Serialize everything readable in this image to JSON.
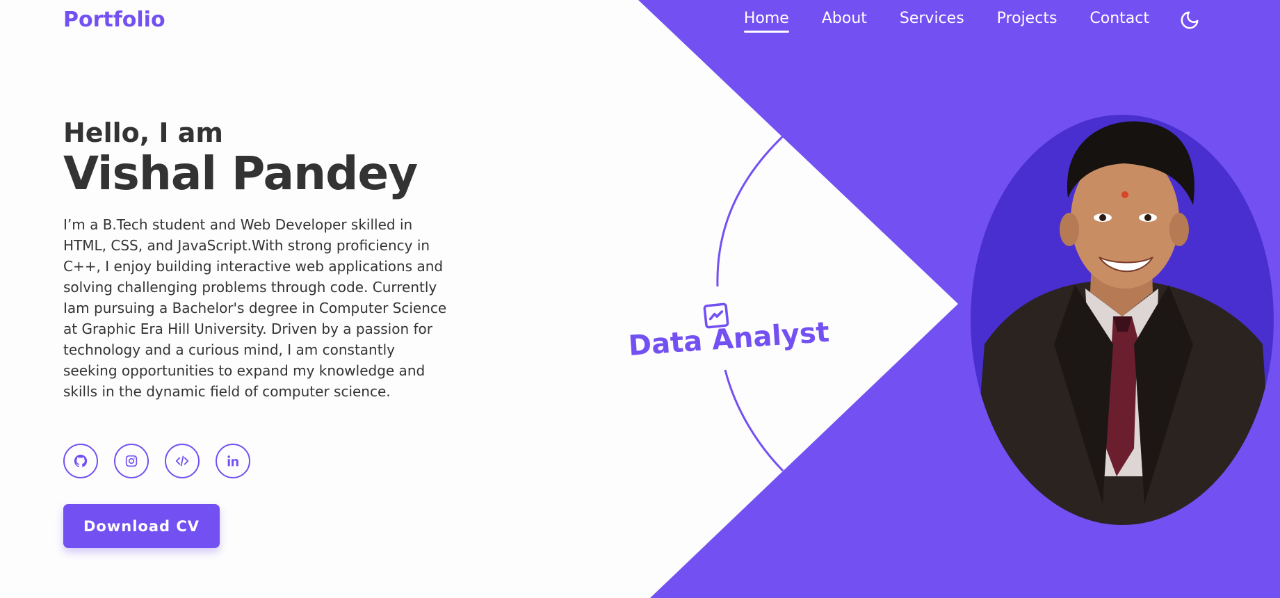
{
  "header": {
    "logo": "Portfolio",
    "nav": [
      {
        "label": "Home",
        "active": true
      },
      {
        "label": "About"
      },
      {
        "label": "Services"
      },
      {
        "label": "Projects"
      },
      {
        "label": "Contact"
      }
    ],
    "theme_icon": "moon-icon"
  },
  "hero": {
    "greeting": "Hello, I am",
    "name": "Vishal Pandey",
    "description": "I’m a B.Tech student and Web Developer skilled in HTML, CSS, and JavaScript.With strong proficiency in C++, I enjoy building interactive web applications and solving challenging problems through code. Currently Iam pursuing a Bachelor's degree in Computer Science at Graphic Era Hill University. Driven by a passion for technology and a curious mind, I am constantly seeking opportunities to expand my knowledge and skills in the dynamic field of computer science.",
    "download_label": "Download CV",
    "role": "Data Analyst",
    "role_icon": "chart-line-icon"
  },
  "socials": [
    {
      "icon": "github-icon"
    },
    {
      "icon": "instagram-icon"
    },
    {
      "icon": "code-icon"
    },
    {
      "icon": "linkedin-icon"
    }
  ],
  "colors": {
    "accent": "#7350f2",
    "accent_dark": "#4a2fd0",
    "text": "#333333",
    "background": "#fdfdfd"
  }
}
